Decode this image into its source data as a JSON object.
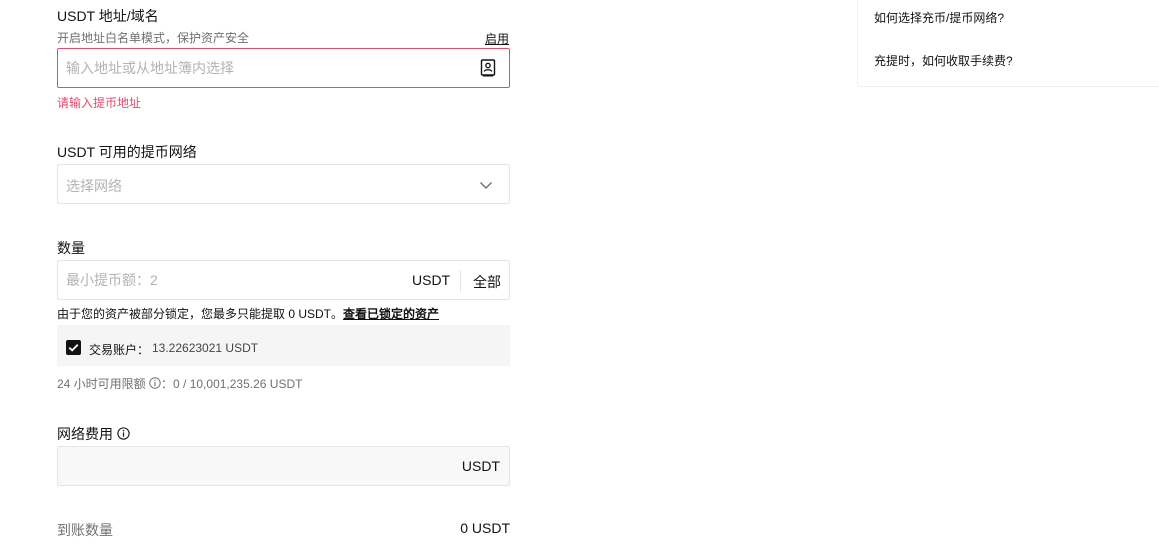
{
  "address": {
    "title": "USDT 地址/域名",
    "whitelist_hint": "开启地址白名单模式，保护资产安全",
    "enable_link": "启用",
    "placeholder": "输入地址或从地址簿内选择",
    "error": "请输入提币地址",
    "icon": "address-book-icon"
  },
  "network": {
    "title": "USDT 可用的提币网络",
    "placeholder": "选择网络",
    "icon": "chevron-down-icon"
  },
  "amount": {
    "title": "数量",
    "placeholder": "最小提币额：2",
    "unit": "USDT",
    "all_button": "全部",
    "lock_note": "由于您的资产被部分锁定，您最多只能提取 0 USDT。",
    "lock_link": "查看已锁定的资产"
  },
  "account": {
    "checked": true,
    "label": "交易账户：",
    "value": "13.22623021 USDT"
  },
  "limit": {
    "label": "24 小时可用限额",
    "value": "：0 / 10,001,235.26 USDT"
  },
  "fee": {
    "title": "网络费用",
    "unit": "USDT"
  },
  "receive": {
    "label": "到账数量",
    "value": "0 USDT"
  },
  "faq": {
    "items": [
      "如何选择充币/提币网络?",
      "充提时，如何收取手续费?"
    ]
  },
  "colors": {
    "error": "#e54b6d",
    "text": "#121212",
    "muted": "#707070",
    "border": "#e5e5e5",
    "panel": "#f5f5f5"
  }
}
